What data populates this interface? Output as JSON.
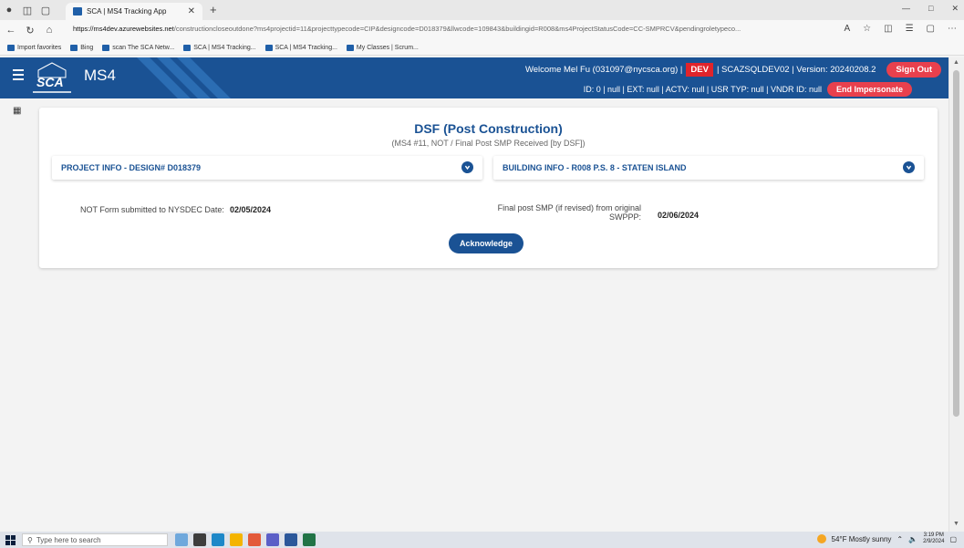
{
  "browser": {
    "tab_title": "SCA | MS4 Tracking App",
    "url_host": "https://ms4dev.azurewebsites.net",
    "url_path": "/constructioncloseoutdone?ms4projectid=11&projecttypecode=CIP&designcode=D018379&llwcode=109843&buildingid=R008&ms4ProjectStatusCode=CC-SMPRCV&pendingroletypeco...",
    "favorites": [
      "Import favorites",
      "Bing",
      "scan The SCA Netw...",
      "SCA | MS4 Tracking...",
      "SCA | MS4 Tracking...",
      "My Classes | Scrum..."
    ]
  },
  "header": {
    "logo": "SCA",
    "brand": "MS4",
    "welcome": "Welcome Mel Fu (031097@nycsca.org) |",
    "env_badge": "DEV",
    "server": "| SCAZSQLDEV02 | Version: 20240208.2",
    "signout_label": "Sign Out",
    "id_line": "ID: 0 | null | EXT: null | ACTV: null | USR TYP: null | VNDR ID: null",
    "end_impersonate_label": "End Impersonate"
  },
  "card": {
    "title": "DSF (Post Construction)",
    "subtitle": "(MS4 #11, NOT / Final Post SMP Received [by DSF])",
    "project_info": "PROJECT INFO - DESIGN# D018379",
    "building_info": "BUILDING INFO - R008 P.S. 8 - STATEN ISLAND",
    "not_form_label": "NOT Form submitted to NYSDEC Date:",
    "not_form_value": "02/05/2024",
    "final_smp_label_1": "Final post SMP (if revised) from original",
    "final_smp_label_2": "SWPPP:",
    "final_smp_value": "02/06/2024",
    "acknowledge_label": "Acknowledge"
  },
  "taskbar": {
    "search_placeholder": "Type here to search",
    "weather": "54°F  Mostly sunny",
    "time": "3:19 PM",
    "date": "2/9/2024"
  },
  "colors": {
    "primary": "#1a5294",
    "danger": "#e0242b"
  }
}
